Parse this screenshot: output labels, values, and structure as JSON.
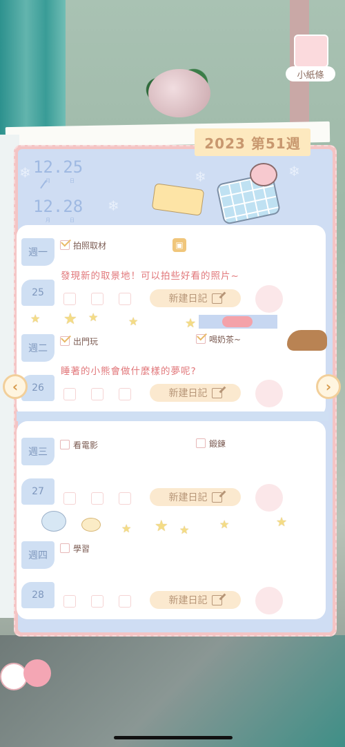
{
  "header": {
    "week_title": "2023 第51週",
    "badge_label": "小紙條"
  },
  "date_range": {
    "start": {
      "day": "12.25",
      "month_unit": "月",
      "day_unit": "日"
    },
    "end": {
      "day": "12.28",
      "month_unit": "月",
      "day_unit": "日"
    }
  },
  "days": [
    {
      "weekday": "週一",
      "date": "25",
      "tasks": [
        {
          "label": "拍照取材",
          "checked": true
        }
      ],
      "note": "發現新的取景地！可以拍些好看的照片~",
      "new_diary_label": "新建日記"
    },
    {
      "weekday": "週二",
      "date": "26",
      "tasks": [
        {
          "label": "出門玩",
          "checked": true
        },
        {
          "label": "喝奶茶~",
          "checked": true
        }
      ],
      "note": "睡著的小熊會做什麼樣的夢呢?",
      "new_diary_label": "新建日記"
    },
    {
      "weekday": "週三",
      "date": "27",
      "tasks": [
        {
          "label": "看電影",
          "checked": false
        },
        {
          "label": "鍛鍊",
          "checked": false
        }
      ],
      "note": "",
      "new_diary_label": "新建日記"
    },
    {
      "weekday": "週四",
      "date": "28",
      "tasks": [
        {
          "label": "學習",
          "checked": false
        }
      ],
      "note": "",
      "new_diary_label": "新建日記"
    }
  ],
  "icons": {
    "prev": "chevron-left-icon",
    "next": "chevron-right-icon",
    "edit": "pencil-icon",
    "gift": "gift-icon",
    "star": "star-icon",
    "snowflake": "snowflake-icon"
  },
  "colors": {
    "book_border": "#f4c4c4",
    "page_blue": "#cfddf3",
    "tab_yellow": "#fde9bf",
    "note_pink": "#e1777a",
    "check_gold": "#e8b966"
  }
}
